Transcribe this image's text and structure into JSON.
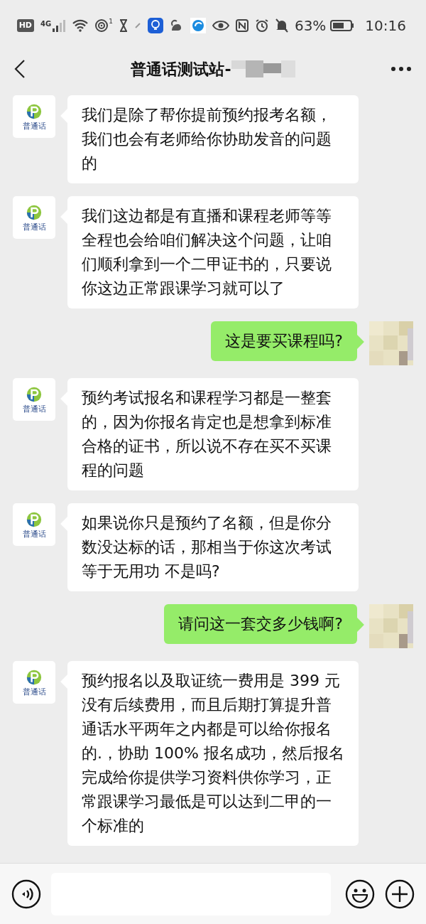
{
  "status_bar": {
    "hd": "HD",
    "network": "4G",
    "hotspot_count": "1",
    "battery": "63%",
    "time": "10:16"
  },
  "header": {
    "title": "普通话测试站-"
  },
  "messages": [
    {
      "kind": "received",
      "avatar_label": "普通话",
      "text": "我们是除了帮你提前预约报考名额，我们也会有老师给你协助发音的问题的"
    },
    {
      "kind": "received",
      "avatar_label": "普通话",
      "text": "我们这边都是有直播和课程老师等等全程也会给咱们解决这个问题，让咱们顺利拿到一个二甲证书的，只要说你这边正常跟课学习就可以了"
    },
    {
      "kind": "sent",
      "text": "这是要买课程吗?"
    },
    {
      "kind": "received",
      "avatar_label": "普通话",
      "text": "预约考试报名和课程学习都是一整套的，因为你报名肯定也是想拿到标准合格的证书，所以说不存在买不买课程的问题"
    },
    {
      "kind": "received",
      "avatar_label": "普通话",
      "text": "如果说你只是预约了名额，但是你分数没达标的话，那相当于你这次考试等于无用功 不是吗?"
    },
    {
      "kind": "sent",
      "text": "请问这一套交多少钱啊?"
    },
    {
      "kind": "received",
      "avatar_label": "普通话",
      "text": "预约报名以及取证统一费用是 399 元没有后续费用，而且后期打算提升普通话水平两年之内都是可以给你报名的.，协助 100% 报名成功，然后报名完成给你提供学习资料供你学习，正常跟课学习最低是可以达到二甲的一个标准的"
    }
  ]
}
